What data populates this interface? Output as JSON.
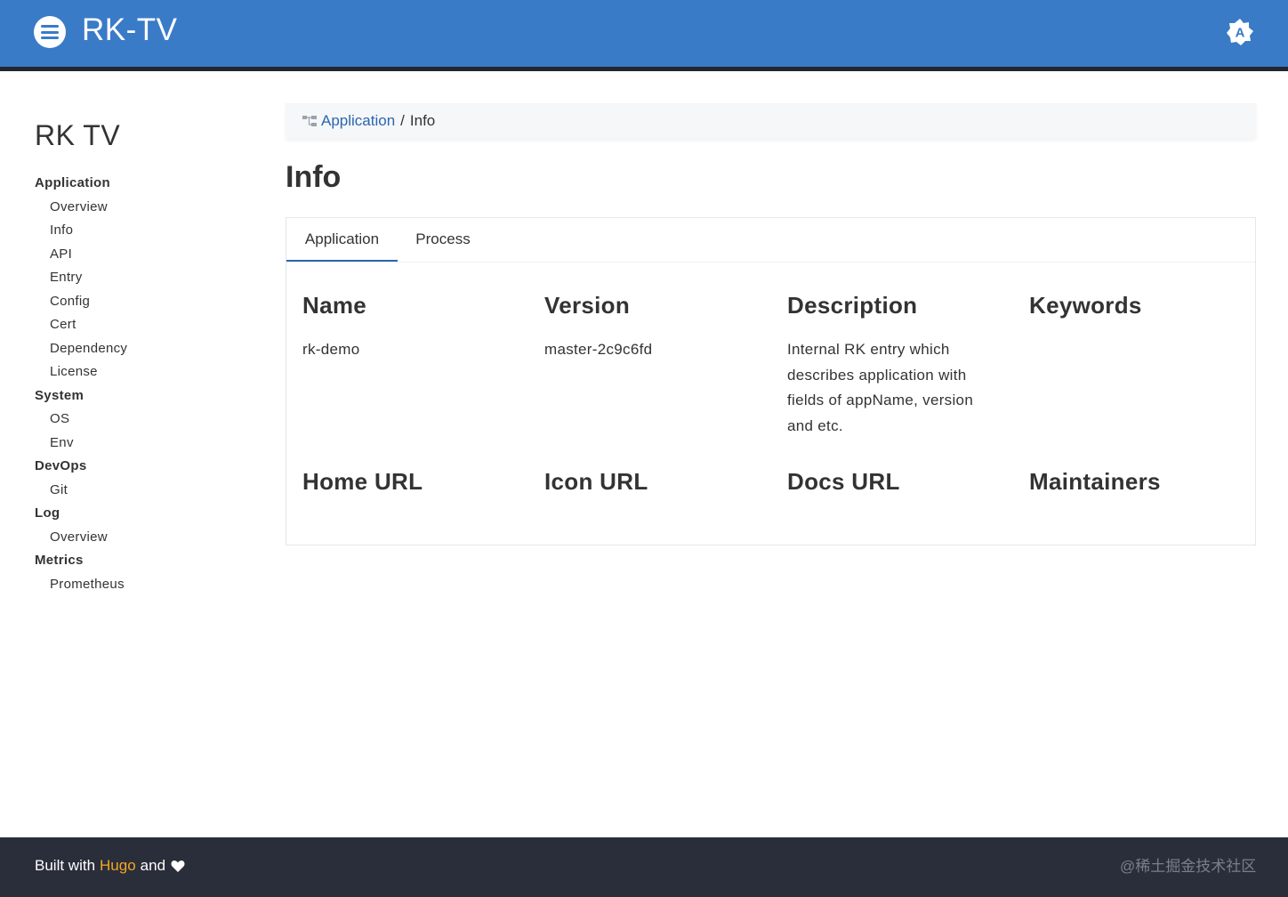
{
  "header": {
    "brand": "RK-TV",
    "logo_icon": "menu-circle-icon",
    "theme_icon": "auto-theme-icon"
  },
  "sidebar": {
    "title": "RK TV",
    "groups": [
      {
        "label": "Application",
        "items": [
          "Overview",
          "Info",
          "API",
          "Entry",
          "Config",
          "Cert",
          "Dependency",
          "License"
        ]
      },
      {
        "label": "System",
        "items": [
          "OS",
          "Env"
        ]
      },
      {
        "label": "DevOps",
        "items": [
          "Git"
        ]
      },
      {
        "label": "Log",
        "items": [
          "Overview"
        ]
      },
      {
        "label": "Metrics",
        "items": [
          "Prometheus"
        ]
      }
    ]
  },
  "breadcrumb": {
    "icon": "sitemap-icon",
    "link": "Application",
    "separator": "/",
    "current": "Info"
  },
  "page": {
    "title": "Info"
  },
  "tabs": [
    {
      "label": "Application",
      "active": true
    },
    {
      "label": "Process",
      "active": false
    }
  ],
  "fields": {
    "name": {
      "label": "Name",
      "value": "rk-demo"
    },
    "version": {
      "label": "Version",
      "value": "master-2c9c6fd"
    },
    "description": {
      "label": "Description",
      "value_lines": [
        "Internal RK entry which",
        "describes application with",
        "fields of appName, version",
        "and etc."
      ]
    },
    "keywords": {
      "label": "Keywords"
    },
    "home_url": {
      "label": "Home URL"
    },
    "icon_url": {
      "label": "Icon URL"
    },
    "docs_url": {
      "label": "Docs URL"
    },
    "maintainers": {
      "label": "Maintainers"
    }
  },
  "footer": {
    "prefix": "Built with",
    "link": "Hugo",
    "suffix": "and",
    "heart_icon": "heart-icon",
    "watermark": "@稀土掘金技术社区"
  },
  "colors": {
    "header_bg": "#3a7bc8",
    "link": "#2a66b0",
    "footer_bg": "#2a2e3a",
    "footer_link": "#f5a623"
  }
}
